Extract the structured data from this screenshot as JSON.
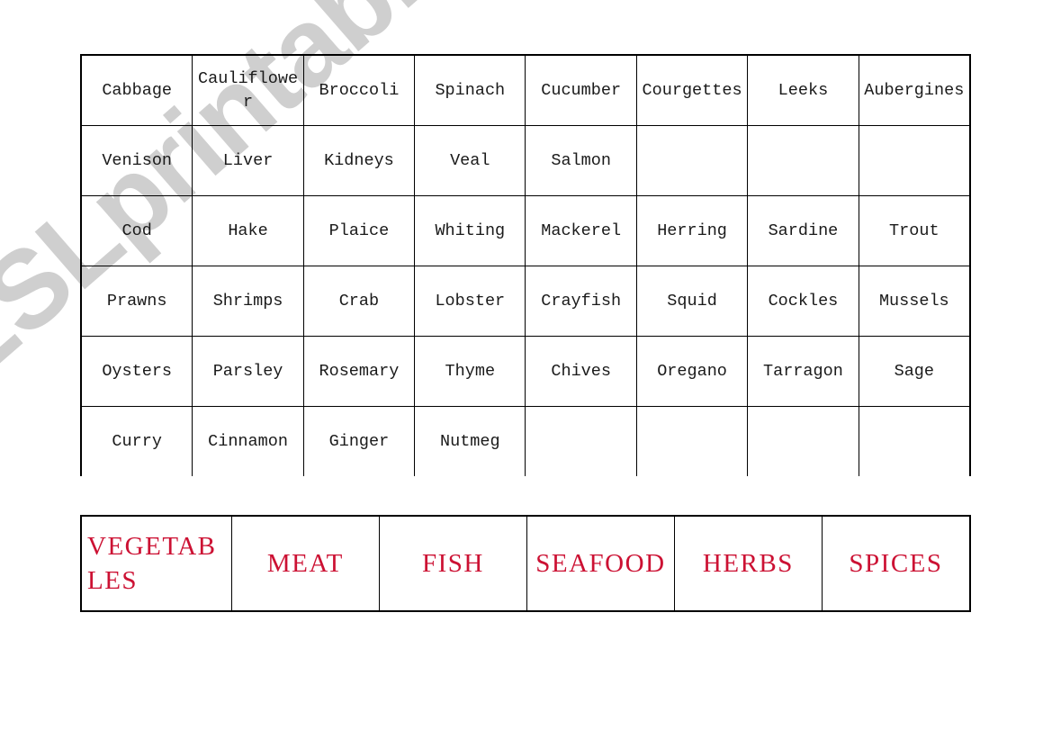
{
  "watermark": {
    "text": "ESLprintables.com",
    "color": "#cfcfcf"
  },
  "colors": {
    "category_red": "#cc1133",
    "grid_line": "#000000",
    "word_text": "#1a1a1a",
    "page_background": "#ffffff"
  },
  "word_grid": {
    "columns": 8,
    "rows": [
      [
        "Cabbage",
        "Cauliflower",
        "Broccoli",
        "Spinach",
        "Cucumber",
        "Courgettes",
        "Leeks",
        "Aubergines"
      ],
      [
        "Venison",
        "Liver",
        "Kidneys",
        "Veal",
        "Salmon",
        "",
        "",
        ""
      ],
      [
        "Cod",
        "Hake",
        "Plaice",
        "Whiting",
        "Mackerel",
        "Herring",
        "Sardine",
        "Trout"
      ],
      [
        "Prawns",
        "Shrimps",
        "Crab",
        "Lobster",
        "Crayfish",
        "Squid",
        "Cockles",
        "Mussels"
      ],
      [
        "Oysters",
        "Parsley",
        "Rosemary",
        "Thyme",
        "Chives",
        "Oregano",
        "Tarragon",
        "Sage"
      ],
      [
        "Curry",
        "Cinnamon",
        "Ginger",
        "Nutmeg",
        "",
        "",
        "",
        ""
      ]
    ]
  },
  "category_grid": {
    "columns": 6,
    "rows": [
      [
        "VEGETABLES",
        "MEAT",
        "FISH",
        "SEAFOOD",
        "HERBS",
        "SPICES"
      ]
    ]
  }
}
